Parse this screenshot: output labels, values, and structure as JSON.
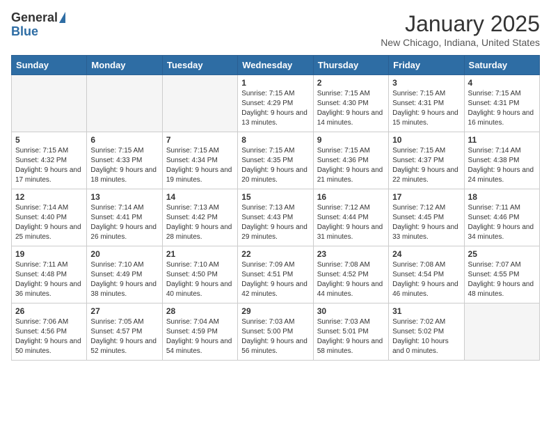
{
  "header": {
    "logo_general": "General",
    "logo_blue": "Blue",
    "month_title": "January 2025",
    "location": "New Chicago, Indiana, United States"
  },
  "weekdays": [
    "Sunday",
    "Monday",
    "Tuesday",
    "Wednesday",
    "Thursday",
    "Friday",
    "Saturday"
  ],
  "weeks": [
    [
      {
        "day": "",
        "sunrise": "",
        "sunset": "",
        "daylight": ""
      },
      {
        "day": "",
        "sunrise": "",
        "sunset": "",
        "daylight": ""
      },
      {
        "day": "",
        "sunrise": "",
        "sunset": "",
        "daylight": ""
      },
      {
        "day": "1",
        "sunrise": "Sunrise: 7:15 AM",
        "sunset": "Sunset: 4:29 PM",
        "daylight": "Daylight: 9 hours and 13 minutes."
      },
      {
        "day": "2",
        "sunrise": "Sunrise: 7:15 AM",
        "sunset": "Sunset: 4:30 PM",
        "daylight": "Daylight: 9 hours and 14 minutes."
      },
      {
        "day": "3",
        "sunrise": "Sunrise: 7:15 AM",
        "sunset": "Sunset: 4:31 PM",
        "daylight": "Daylight: 9 hours and 15 minutes."
      },
      {
        "day": "4",
        "sunrise": "Sunrise: 7:15 AM",
        "sunset": "Sunset: 4:31 PM",
        "daylight": "Daylight: 9 hours and 16 minutes."
      }
    ],
    [
      {
        "day": "5",
        "sunrise": "Sunrise: 7:15 AM",
        "sunset": "Sunset: 4:32 PM",
        "daylight": "Daylight: 9 hours and 17 minutes."
      },
      {
        "day": "6",
        "sunrise": "Sunrise: 7:15 AM",
        "sunset": "Sunset: 4:33 PM",
        "daylight": "Daylight: 9 hours and 18 minutes."
      },
      {
        "day": "7",
        "sunrise": "Sunrise: 7:15 AM",
        "sunset": "Sunset: 4:34 PM",
        "daylight": "Daylight: 9 hours and 19 minutes."
      },
      {
        "day": "8",
        "sunrise": "Sunrise: 7:15 AM",
        "sunset": "Sunset: 4:35 PM",
        "daylight": "Daylight: 9 hours and 20 minutes."
      },
      {
        "day": "9",
        "sunrise": "Sunrise: 7:15 AM",
        "sunset": "Sunset: 4:36 PM",
        "daylight": "Daylight: 9 hours and 21 minutes."
      },
      {
        "day": "10",
        "sunrise": "Sunrise: 7:15 AM",
        "sunset": "Sunset: 4:37 PM",
        "daylight": "Daylight: 9 hours and 22 minutes."
      },
      {
        "day": "11",
        "sunrise": "Sunrise: 7:14 AM",
        "sunset": "Sunset: 4:38 PM",
        "daylight": "Daylight: 9 hours and 24 minutes."
      }
    ],
    [
      {
        "day": "12",
        "sunrise": "Sunrise: 7:14 AM",
        "sunset": "Sunset: 4:40 PM",
        "daylight": "Daylight: 9 hours and 25 minutes."
      },
      {
        "day": "13",
        "sunrise": "Sunrise: 7:14 AM",
        "sunset": "Sunset: 4:41 PM",
        "daylight": "Daylight: 9 hours and 26 minutes."
      },
      {
        "day": "14",
        "sunrise": "Sunrise: 7:13 AM",
        "sunset": "Sunset: 4:42 PM",
        "daylight": "Daylight: 9 hours and 28 minutes."
      },
      {
        "day": "15",
        "sunrise": "Sunrise: 7:13 AM",
        "sunset": "Sunset: 4:43 PM",
        "daylight": "Daylight: 9 hours and 29 minutes."
      },
      {
        "day": "16",
        "sunrise": "Sunrise: 7:12 AM",
        "sunset": "Sunset: 4:44 PM",
        "daylight": "Daylight: 9 hours and 31 minutes."
      },
      {
        "day": "17",
        "sunrise": "Sunrise: 7:12 AM",
        "sunset": "Sunset: 4:45 PM",
        "daylight": "Daylight: 9 hours and 33 minutes."
      },
      {
        "day": "18",
        "sunrise": "Sunrise: 7:11 AM",
        "sunset": "Sunset: 4:46 PM",
        "daylight": "Daylight: 9 hours and 34 minutes."
      }
    ],
    [
      {
        "day": "19",
        "sunrise": "Sunrise: 7:11 AM",
        "sunset": "Sunset: 4:48 PM",
        "daylight": "Daylight: 9 hours and 36 minutes."
      },
      {
        "day": "20",
        "sunrise": "Sunrise: 7:10 AM",
        "sunset": "Sunset: 4:49 PM",
        "daylight": "Daylight: 9 hours and 38 minutes."
      },
      {
        "day": "21",
        "sunrise": "Sunrise: 7:10 AM",
        "sunset": "Sunset: 4:50 PM",
        "daylight": "Daylight: 9 hours and 40 minutes."
      },
      {
        "day": "22",
        "sunrise": "Sunrise: 7:09 AM",
        "sunset": "Sunset: 4:51 PM",
        "daylight": "Daylight: 9 hours and 42 minutes."
      },
      {
        "day": "23",
        "sunrise": "Sunrise: 7:08 AM",
        "sunset": "Sunset: 4:52 PM",
        "daylight": "Daylight: 9 hours and 44 minutes."
      },
      {
        "day": "24",
        "sunrise": "Sunrise: 7:08 AM",
        "sunset": "Sunset: 4:54 PM",
        "daylight": "Daylight: 9 hours and 46 minutes."
      },
      {
        "day": "25",
        "sunrise": "Sunrise: 7:07 AM",
        "sunset": "Sunset: 4:55 PM",
        "daylight": "Daylight: 9 hours and 48 minutes."
      }
    ],
    [
      {
        "day": "26",
        "sunrise": "Sunrise: 7:06 AM",
        "sunset": "Sunset: 4:56 PM",
        "daylight": "Daylight: 9 hours and 50 minutes."
      },
      {
        "day": "27",
        "sunrise": "Sunrise: 7:05 AM",
        "sunset": "Sunset: 4:57 PM",
        "daylight": "Daylight: 9 hours and 52 minutes."
      },
      {
        "day": "28",
        "sunrise": "Sunrise: 7:04 AM",
        "sunset": "Sunset: 4:59 PM",
        "daylight": "Daylight: 9 hours and 54 minutes."
      },
      {
        "day": "29",
        "sunrise": "Sunrise: 7:03 AM",
        "sunset": "Sunset: 5:00 PM",
        "daylight": "Daylight: 9 hours and 56 minutes."
      },
      {
        "day": "30",
        "sunrise": "Sunrise: 7:03 AM",
        "sunset": "Sunset: 5:01 PM",
        "daylight": "Daylight: 9 hours and 58 minutes."
      },
      {
        "day": "31",
        "sunrise": "Sunrise: 7:02 AM",
        "sunset": "Sunset: 5:02 PM",
        "daylight": "Daylight: 10 hours and 0 minutes."
      },
      {
        "day": "",
        "sunrise": "",
        "sunset": "",
        "daylight": ""
      }
    ]
  ]
}
